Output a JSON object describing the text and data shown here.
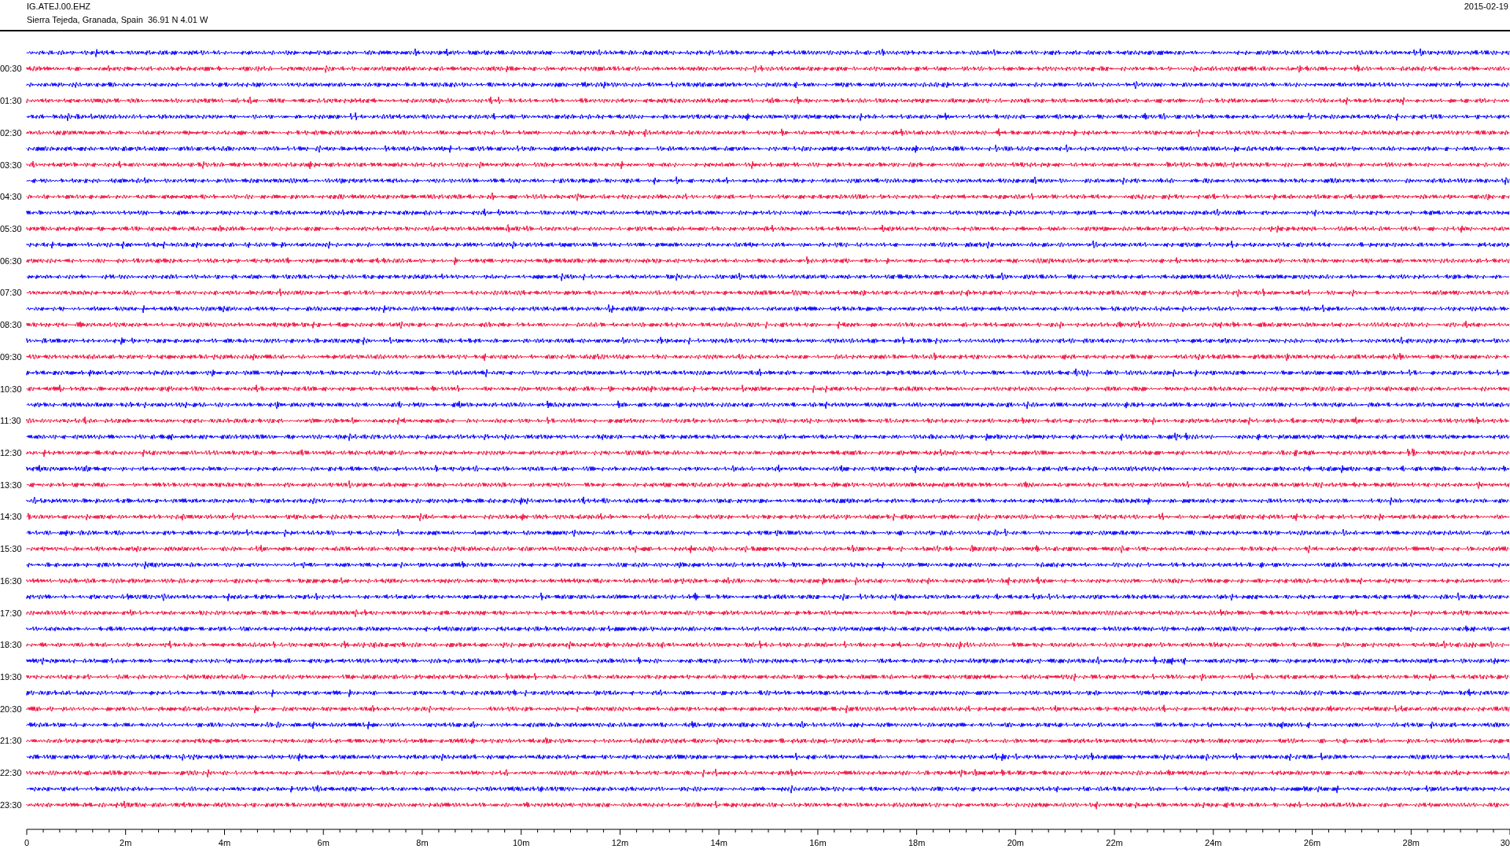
{
  "station": {
    "code": "IG.ATEJ.00.EHZ",
    "location": "Sierra Tejeda, Granada, Spain  36.91 N 4.01 W",
    "date": "2015-02-19"
  },
  "traces": [
    {
      "color": "#0000ff"
    },
    {
      "color": "#f0103c",
      "label": "00:30"
    },
    {
      "color": "#0000ff"
    },
    {
      "color": "#f0103c",
      "label": "01:30"
    },
    {
      "color": "#0000ff"
    },
    {
      "color": "#f0103c",
      "label": "02:30"
    },
    {
      "color": "#0000ff"
    },
    {
      "color": "#f0103c",
      "label": "03:30"
    },
    {
      "color": "#0000ff"
    },
    {
      "color": "#f0103c",
      "label": "04:30"
    },
    {
      "color": "#0000ff"
    },
    {
      "color": "#f0103c",
      "label": "05:30"
    },
    {
      "color": "#0000ff"
    },
    {
      "color": "#f0103c",
      "label": "06:30"
    },
    {
      "color": "#0000ff"
    },
    {
      "color": "#f0103c",
      "label": "07:30"
    },
    {
      "color": "#0000ff"
    },
    {
      "color": "#f0103c",
      "label": "08:30"
    },
    {
      "color": "#0000ff"
    },
    {
      "color": "#f0103c",
      "label": "09:30"
    },
    {
      "color": "#0000ff"
    },
    {
      "color": "#f0103c",
      "label": "10:30"
    },
    {
      "color": "#0000ff"
    },
    {
      "color": "#f0103c",
      "label": "11:30"
    },
    {
      "color": "#0000ff"
    },
    {
      "color": "#f0103c",
      "label": "12:30"
    },
    {
      "color": "#0000ff"
    },
    {
      "color": "#f0103c",
      "label": "13:30"
    },
    {
      "color": "#0000ff"
    },
    {
      "color": "#f0103c",
      "label": "14:30"
    },
    {
      "color": "#0000ff"
    },
    {
      "color": "#f0103c",
      "label": "15:30"
    },
    {
      "color": "#0000ff"
    },
    {
      "color": "#f0103c",
      "label": "16:30"
    },
    {
      "color": "#0000ff"
    },
    {
      "color": "#f0103c",
      "label": "17:30"
    },
    {
      "color": "#0000ff"
    },
    {
      "color": "#f0103c",
      "label": "18:30"
    },
    {
      "color": "#0000ff"
    },
    {
      "color": "#f0103c",
      "label": "19:30"
    },
    {
      "color": "#0000ff"
    },
    {
      "color": "#f0103c",
      "label": "20:30"
    },
    {
      "color": "#0000ff"
    },
    {
      "color": "#f0103c",
      "label": "21:30"
    },
    {
      "color": "#0000ff"
    },
    {
      "color": "#f0103c",
      "label": "22:30"
    },
    {
      "color": "#0000ff"
    },
    {
      "color": "#f0103c",
      "label": "23:30"
    }
  ],
  "x_axis": {
    "ticks": [
      "0",
      "2m",
      "4m",
      "6m",
      "8m",
      "10m",
      "12m",
      "14m",
      "16m",
      "18m",
      "20m",
      "22m",
      "24m",
      "26m",
      "28m",
      "30"
    ]
  }
}
